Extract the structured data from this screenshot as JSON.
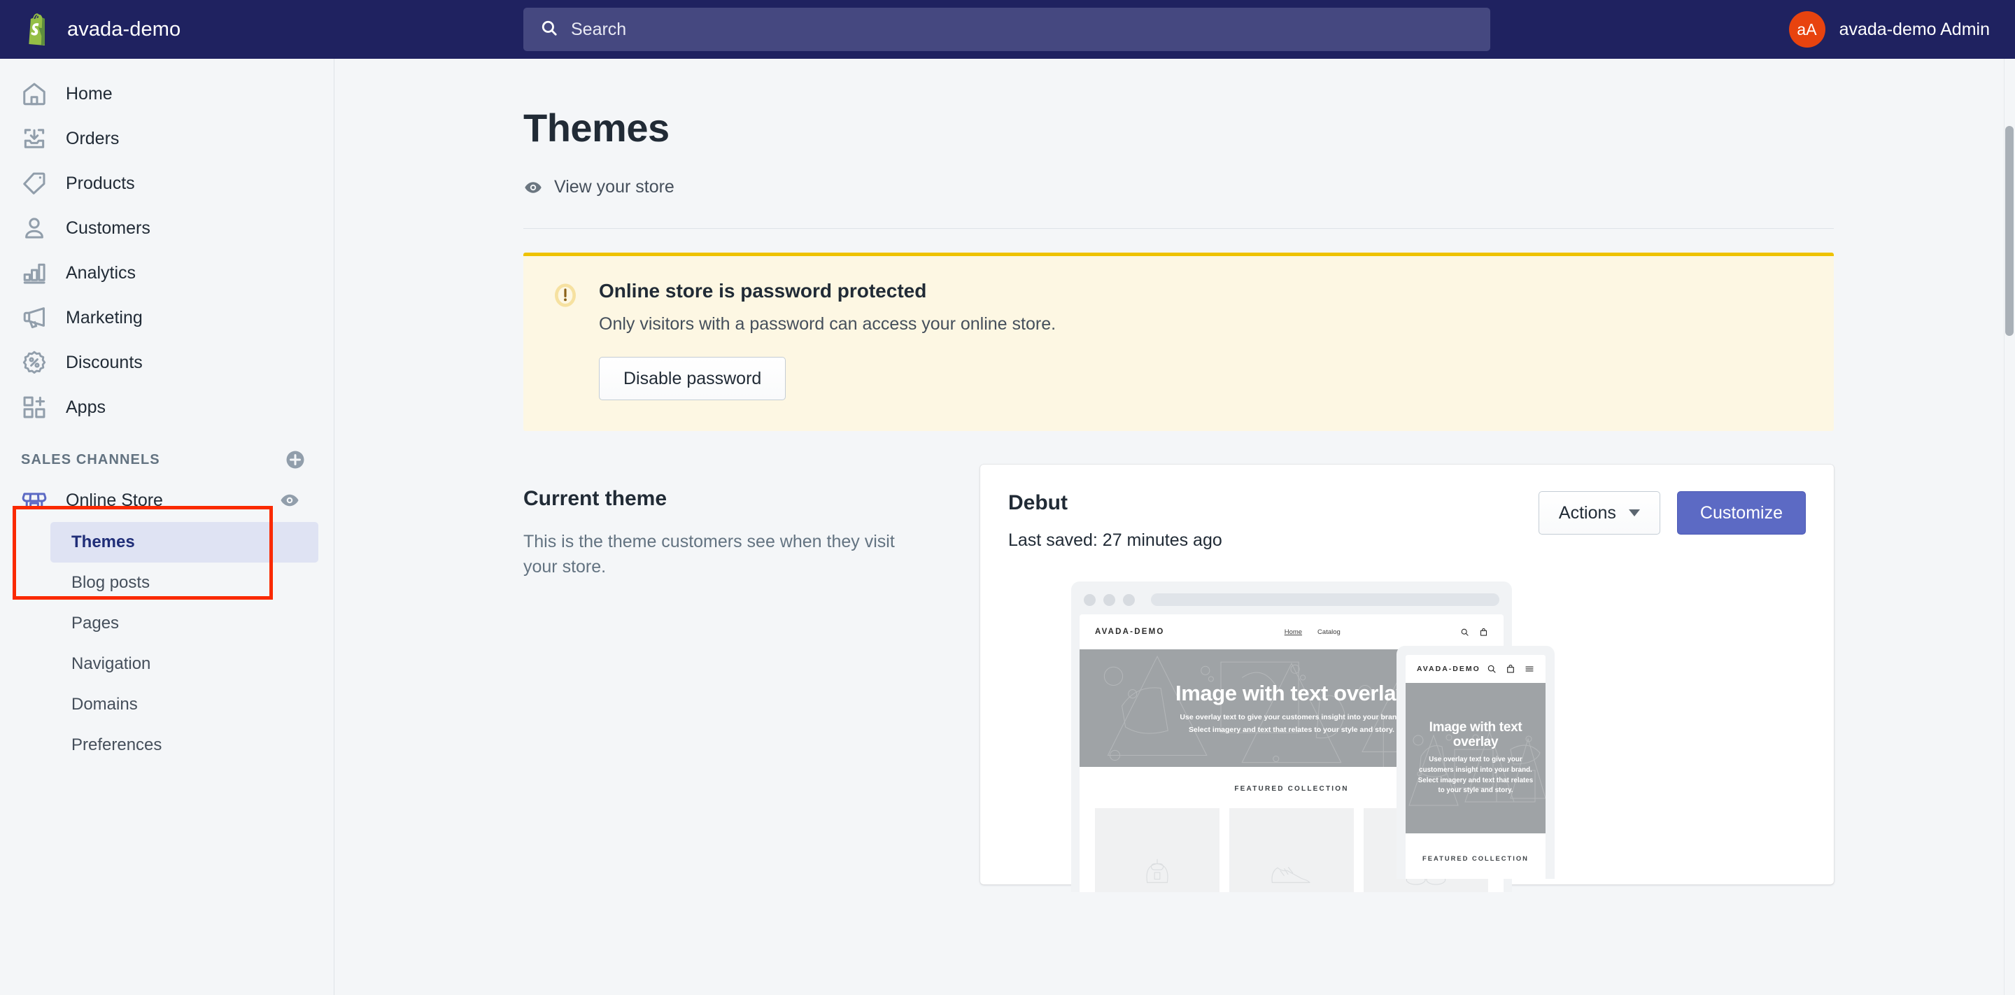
{
  "topbar": {
    "store_name": "avada-demo",
    "logo_icon": "shopify-bag-icon",
    "search": {
      "icon": "search-icon",
      "placeholder": "Search",
      "value": ""
    },
    "admin": {
      "initials": "aA",
      "label": "avada-demo Admin",
      "avatar_color": "#e8430f"
    }
  },
  "sidebar": {
    "items": [
      {
        "label": "Home",
        "icon": "home-icon"
      },
      {
        "label": "Orders",
        "icon": "orders-inbox-icon"
      },
      {
        "label": "Products",
        "icon": "product-tag-icon"
      },
      {
        "label": "Customers",
        "icon": "customer-person-icon"
      },
      {
        "label": "Analytics",
        "icon": "analytics-bar-chart-icon"
      },
      {
        "label": "Marketing",
        "icon": "marketing-megaphone-icon"
      },
      {
        "label": "Discounts",
        "icon": "discount-percent-badge-icon"
      },
      {
        "label": "Apps",
        "icon": "apps-grid-plus-icon"
      }
    ],
    "section": {
      "title": "SALES CHANNELS",
      "add_icon": "circle-plus-icon"
    },
    "channel": {
      "label": "Online Store",
      "icon": "online-store-icon",
      "view_icon": "eye-icon"
    },
    "sub_items": [
      {
        "label": "Themes",
        "active": true
      },
      {
        "label": "Blog posts",
        "active": false
      },
      {
        "label": "Pages",
        "active": false
      },
      {
        "label": "Navigation",
        "active": false
      },
      {
        "label": "Domains",
        "active": false
      },
      {
        "label": "Preferences",
        "active": false
      }
    ],
    "annotation": {
      "color": "#fa2a00",
      "covers": "Online Store / Themes"
    }
  },
  "main": {
    "page_title": "Themes",
    "view_store": {
      "label": "View your store",
      "icon": "eye-icon"
    },
    "banner": {
      "icon": "alert-circle-icon",
      "title": "Online store is password protected",
      "text": "Only visitors with a password can access your online store.",
      "button_label": "Disable password",
      "border_color": "#eec200",
      "background_color": "#fdf7e3"
    },
    "current_theme": {
      "heading": "Current theme",
      "description": "This is the theme customers see when they visit your store.",
      "name": "Debut",
      "last_saved": "Last saved: 27 minutes ago",
      "actions_label": "Actions",
      "actions_caret": "chevron-down-icon",
      "customize_label": "Customize",
      "customize_color": "#5c6ac4"
    },
    "preview": {
      "desktop": {
        "logo": "AVADA-DEMO",
        "links": [
          "Home",
          "Catalog"
        ],
        "icons": [
          "search-icon",
          "shopping-bag-icon"
        ],
        "hero_title": "Image with text overlay",
        "hero_line1": "Use overlay text to give your customers insight into your brand.",
        "hero_line2": "Select imagery and text that relates to your style and story.",
        "featured_title": "FEATURED COLLECTION",
        "product_icons": [
          "backpack-icon",
          "sneaker-icon",
          "sunglasses-icon"
        ]
      },
      "mobile": {
        "logo": "AVADA-DEMO",
        "icons": [
          "search-icon",
          "shopping-bag-icon",
          "hamburger-menu-icon"
        ],
        "hero_title": "Image with text overlay",
        "hero_text": "Use overlay text to give your customers insight into your brand. Select imagery and text that relates to your style and story.",
        "featured_title": "FEATURED COLLECTION"
      }
    }
  }
}
